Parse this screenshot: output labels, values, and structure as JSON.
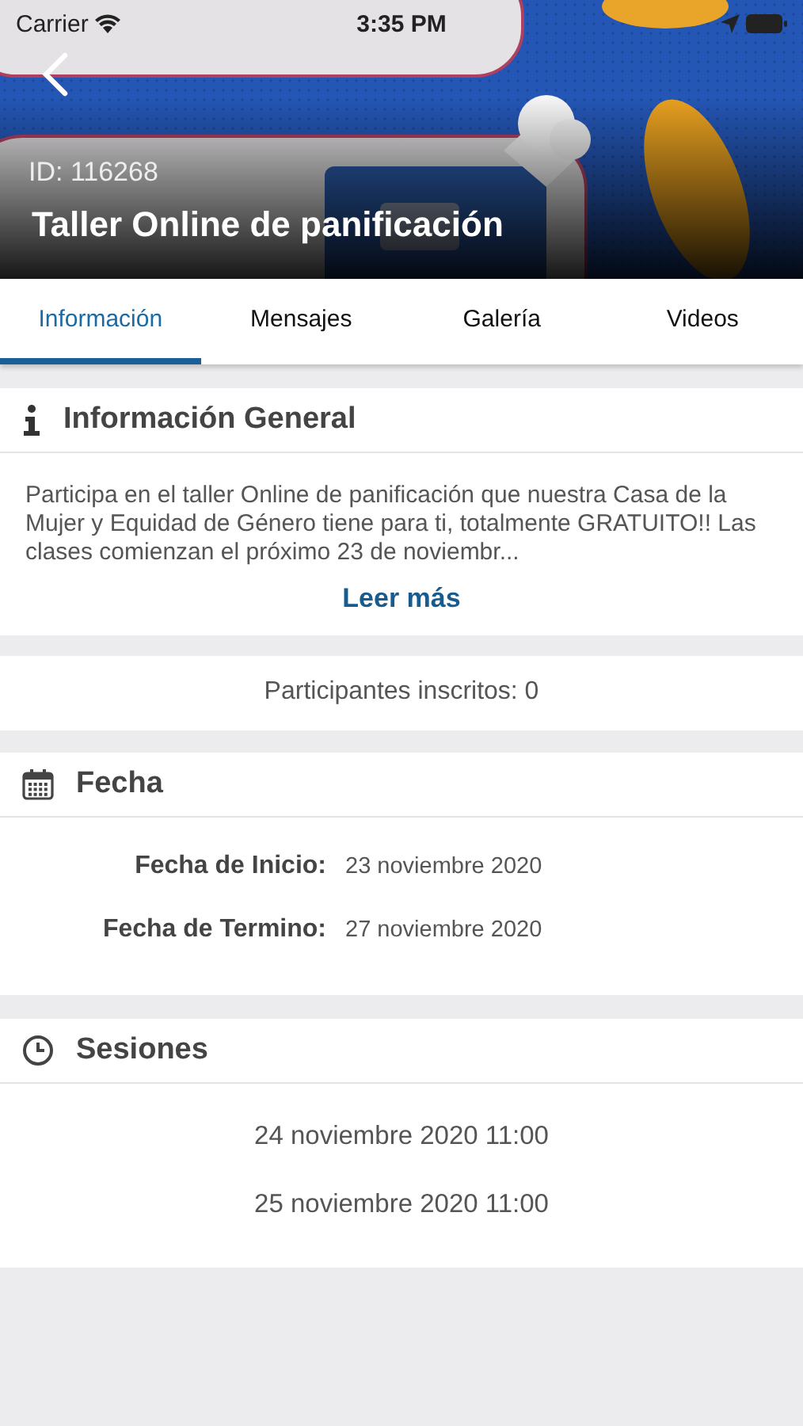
{
  "status_bar": {
    "carrier": "Carrier",
    "time": "3:35 PM"
  },
  "header": {
    "id": "ID: 116268",
    "title": "Taller Online de panificación"
  },
  "tabs": [
    {
      "label": "Información",
      "selected": true
    },
    {
      "label": "Mensajes",
      "selected": false
    },
    {
      "label": "Galería",
      "selected": false
    },
    {
      "label": "Videos",
      "selected": false
    }
  ],
  "info": {
    "title": "Información General",
    "description": "Participa en el taller Online de panificación que nuestra Casa de la Mujer y Equidad de Género tiene para ti, totalmente GRATUITO!! Las clases comienzan el próximo 23 de noviembr...",
    "read_more": "Leer más"
  },
  "participants": "Participantes inscritos: 0",
  "dates": {
    "title": "Fecha",
    "rows": [
      {
        "label": "Fecha de Inicio:",
        "value": "23 noviembre 2020"
      },
      {
        "label": "Fecha de Termino:",
        "value": "27 noviembre 2020"
      }
    ]
  },
  "sessions": {
    "title": "Sesiones",
    "items": [
      "24 noviembre 2020 11:00",
      "25 noviembre 2020 11:00"
    ]
  }
}
